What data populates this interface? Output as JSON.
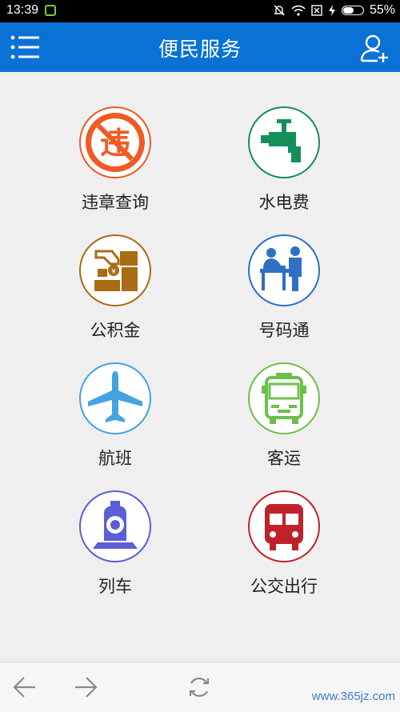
{
  "statusbar": {
    "time": "13:39",
    "battery_text": "55%",
    "battery_level": 0.55
  },
  "header": {
    "title": "便民服务",
    "menu_icon": "list-menu-icon",
    "user_icon": "user-add-icon",
    "color": "#0a72d4"
  },
  "services": [
    {
      "label": "违章查询",
      "icon": "traffic-violation-icon",
      "color": "#f05a24"
    },
    {
      "label": "水电费",
      "icon": "water-tap-icon",
      "color": "#13905a"
    },
    {
      "label": "公积金",
      "icon": "housing-fund-icon",
      "color": "#a86c12"
    },
    {
      "label": "号码通",
      "icon": "service-desk-icon",
      "color": "#2f6fc4"
    },
    {
      "label": "航班",
      "icon": "airplane-icon",
      "color": "#44a3e0"
    },
    {
      "label": "客运",
      "icon": "bus-icon",
      "color": "#6cc04a"
    },
    {
      "label": "列车",
      "icon": "train-icon",
      "color": "#5b5fd6"
    },
    {
      "label": "公交出行",
      "icon": "city-bus-icon",
      "color": "#c0222a"
    }
  ],
  "footer": {
    "back_icon": "arrow-left-icon",
    "forward_icon": "arrow-right-icon",
    "refresh_icon": "refresh-icon",
    "watermark": "www.365jz.com"
  }
}
